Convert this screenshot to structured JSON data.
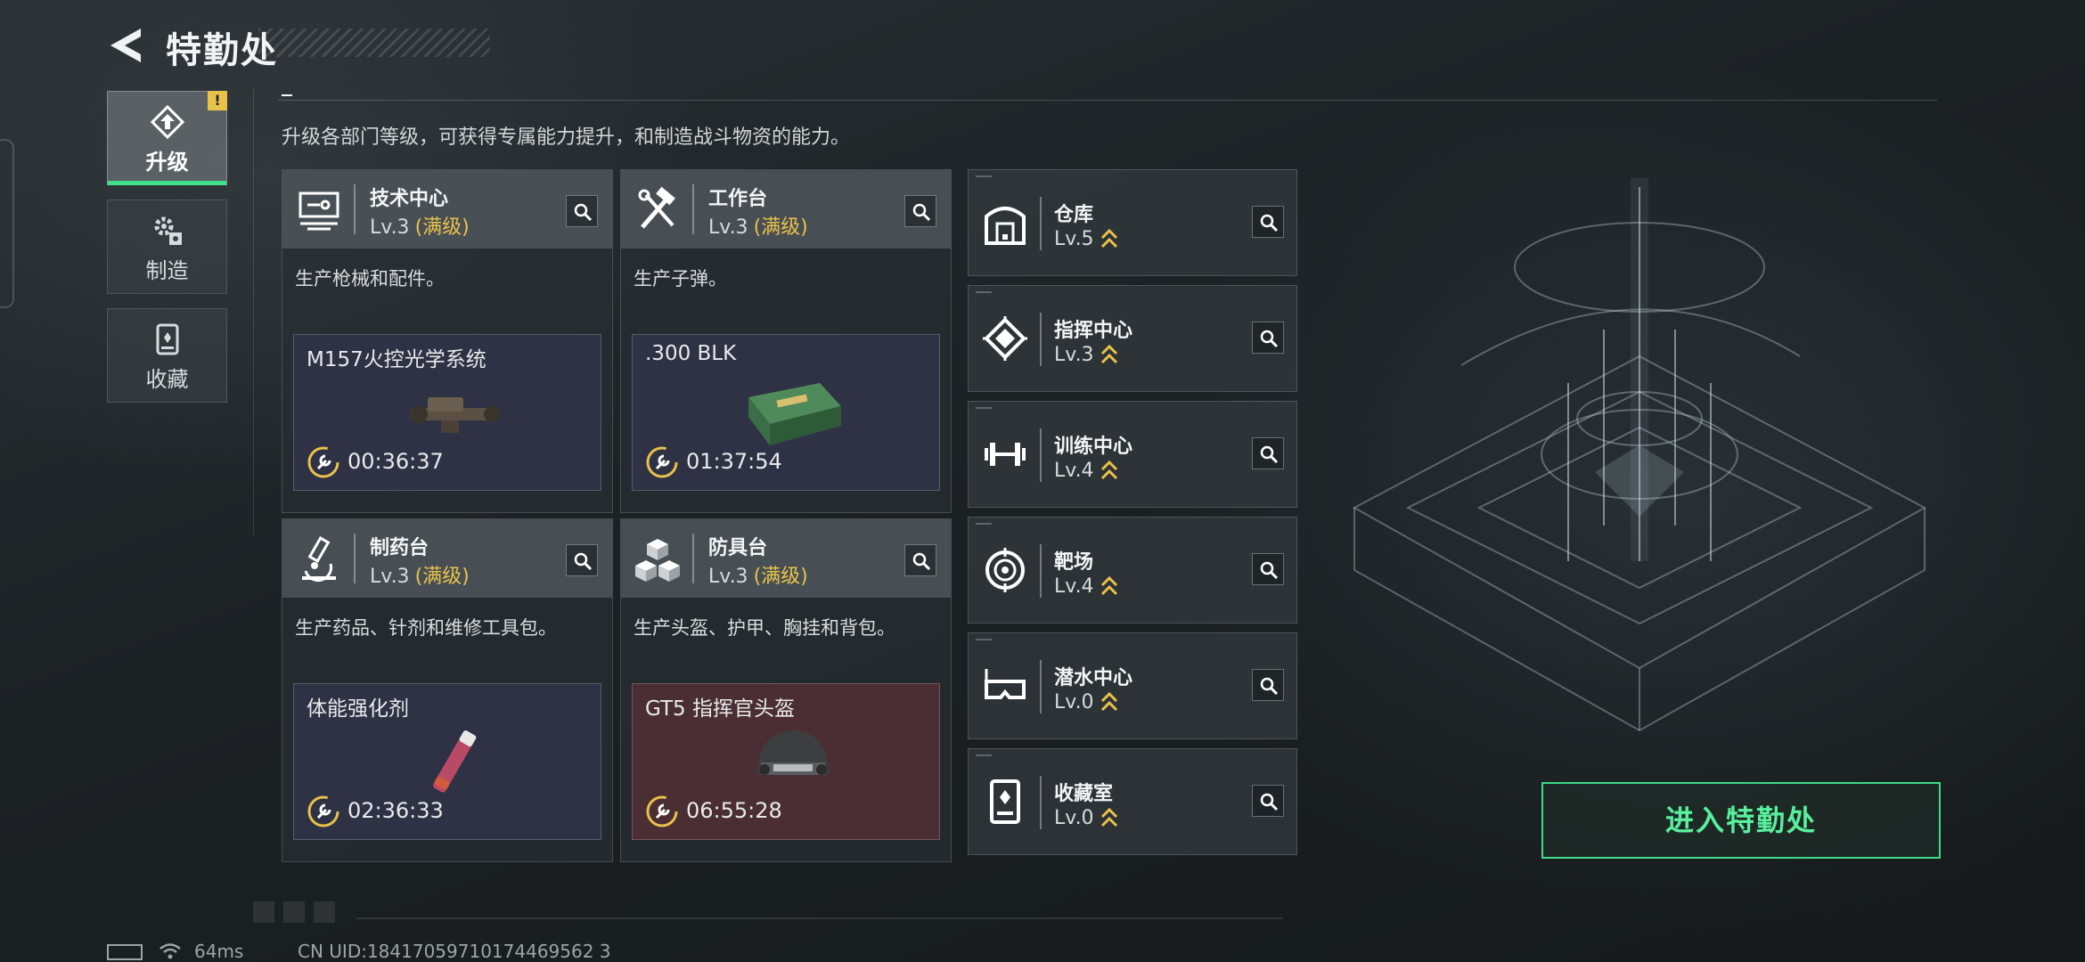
{
  "header": {
    "title": "特勤处"
  },
  "nav": {
    "tabs": [
      {
        "label": "升级",
        "icon": "upgrade-icon",
        "active": true,
        "badge": "!"
      },
      {
        "label": "制造",
        "icon": "gears-icon",
        "active": false
      },
      {
        "label": "收藏",
        "icon": "collection-icon",
        "active": false
      }
    ]
  },
  "subtitle": "升级各部门等级，可获得专属能力提升，和制造战斗物资的能力。",
  "cards": [
    {
      "name": "技术中心",
      "level": "Lv.3",
      "max": "(满级)",
      "icon": "tech-center-icon",
      "desc": "生产枪械和配件。",
      "craft": {
        "item": "M157火控光学系统",
        "timer": "00:36:37",
        "image": "optic-scope-image"
      }
    },
    {
      "name": "工作台",
      "level": "Lv.3",
      "max": "(满级)",
      "icon": "workbench-tools-icon",
      "desc": "生产子弹。",
      "craft": {
        "item": ".300 BLK",
        "timer": "01:37:54",
        "image": "ammo-box-image"
      }
    },
    {
      "name": "制药台",
      "level": "Lv.3",
      "max": "(满级)",
      "icon": "microscope-icon",
      "desc": "生产药品、针剂和维修工具包。",
      "craft": {
        "item": "体能强化剂",
        "timer": "02:36:33",
        "image": "injector-image"
      }
    },
    {
      "name": "防具台",
      "level": "Lv.3",
      "max": "(满级)",
      "icon": "armor-cubes-icon",
      "desc": "生产头盔、护甲、胸挂和背包。",
      "craft": {
        "item": "GT5 指挥官头盔",
        "timer": "06:55:28",
        "image": "helmet-image"
      }
    }
  ],
  "facilities": [
    {
      "name": "仓库",
      "level": "Lv.5",
      "icon": "warehouse-icon"
    },
    {
      "name": "指挥中心",
      "level": "Lv.3",
      "icon": "command-chip-icon"
    },
    {
      "name": "训练中心",
      "level": "Lv.4",
      "icon": "dumbbell-icon"
    },
    {
      "name": "靶场",
      "level": "Lv.4",
      "icon": "target-icon"
    },
    {
      "name": "潜水中心",
      "level": "Lv.0",
      "icon": "dive-mask-icon"
    },
    {
      "name": "收藏室",
      "level": "Lv.0",
      "icon": "display-case-icon"
    }
  ],
  "enter_button": "进入特勤处",
  "status": {
    "ping": "64ms",
    "uid": "CN UID:18417059710174469562 3"
  },
  "colors": {
    "accent_green": "#3fe08a",
    "max_gold": "#e9c24a",
    "timer_ring": "#e9c24a"
  }
}
